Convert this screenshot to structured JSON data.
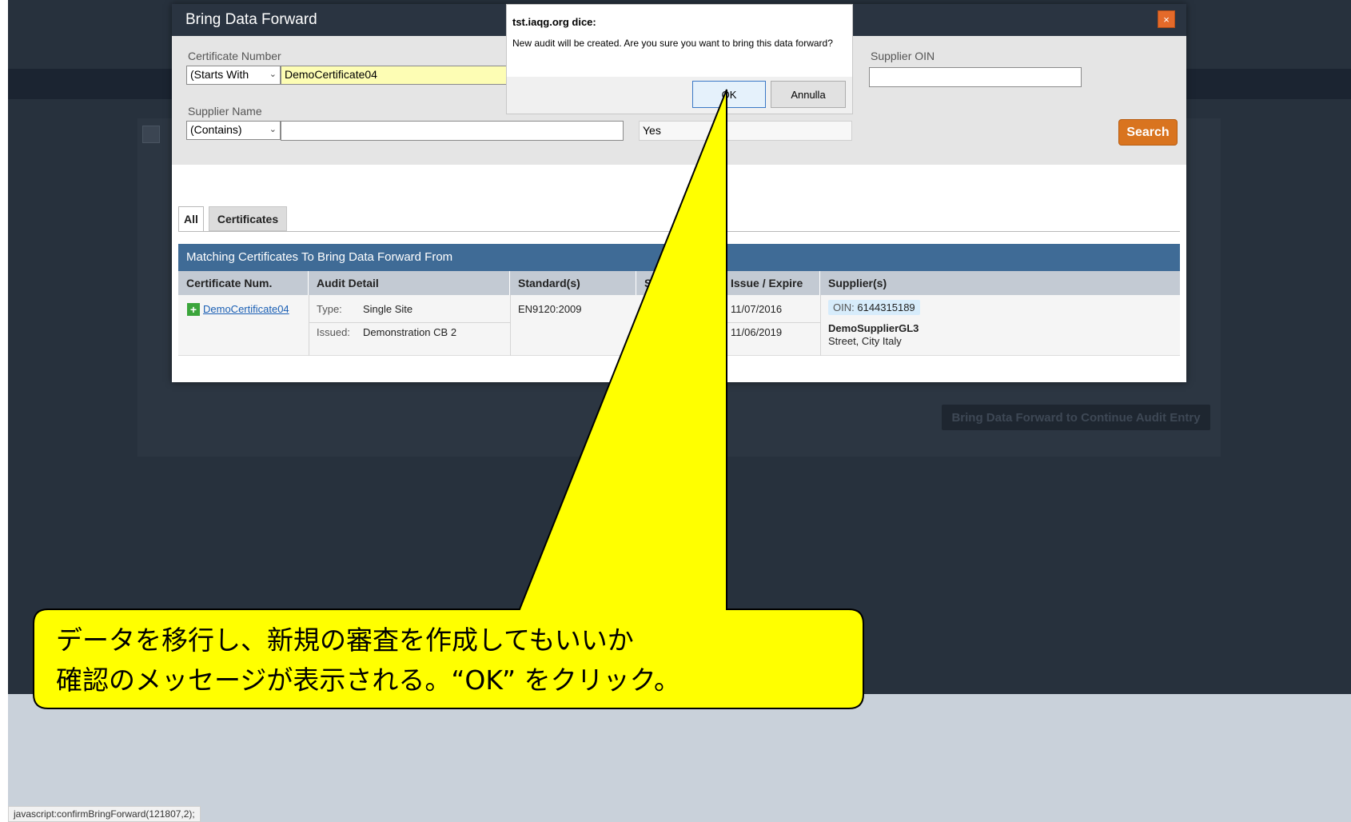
{
  "modal": {
    "title": "Bring Data Forward",
    "close_label": "×",
    "filters": {
      "cert_number_label": "Certificate Number",
      "cert_number_mode": "(Starts With",
      "cert_number_value": "DemoCertificate04",
      "supplier_oin_label": "Supplier OIN",
      "supplier_oin_value": "",
      "supplier_name_label": "Supplier Name",
      "supplier_name_mode": "(Contains)",
      "supplier_name_value": "",
      "extra_value": "Yes",
      "search_label": "Search"
    },
    "tabs": [
      "All",
      "Certificates"
    ],
    "table": {
      "title": "Matching Certificates To Bring Data Forward From",
      "columns": [
        "Certificate Num.",
        "Audit Detail",
        "Standard(s)",
        "S",
        "Issue / Expire",
        "Supplier(s)"
      ],
      "rows": [
        {
          "cert_num": "DemoCertificate04",
          "type_label": "Type:",
          "type_value": "Single Site",
          "issued_label": "Issued:",
          "issued_value": "Demonstration CB 2",
          "standard": "EN9120:2009",
          "issue": "11/07/2016",
          "expire": "11/06/2019",
          "oin_label": "OIN:",
          "oin_value": "6144315189",
          "supplier_name": "DemoSupplierGL3",
          "supplier_address": "Street, City Italy"
        }
      ]
    }
  },
  "confirm": {
    "title": "tst.iaqg.org dice:",
    "message": "New audit will be created. Are you sure you want to bring this data forward?",
    "ok_label": "OK",
    "cancel_label": "Annulla"
  },
  "background": {
    "action_button": "Bring Data Forward to Continue Audit Entry"
  },
  "callout": {
    "line1": "データを移行し、新規の審査を作成してもいいか",
    "line2": "確認のメッセージが表示される。“OK” をクリック。",
    "color": "#ffff00"
  },
  "status_bar": {
    "url": "javascript:confirmBringForward(121807,2);"
  }
}
